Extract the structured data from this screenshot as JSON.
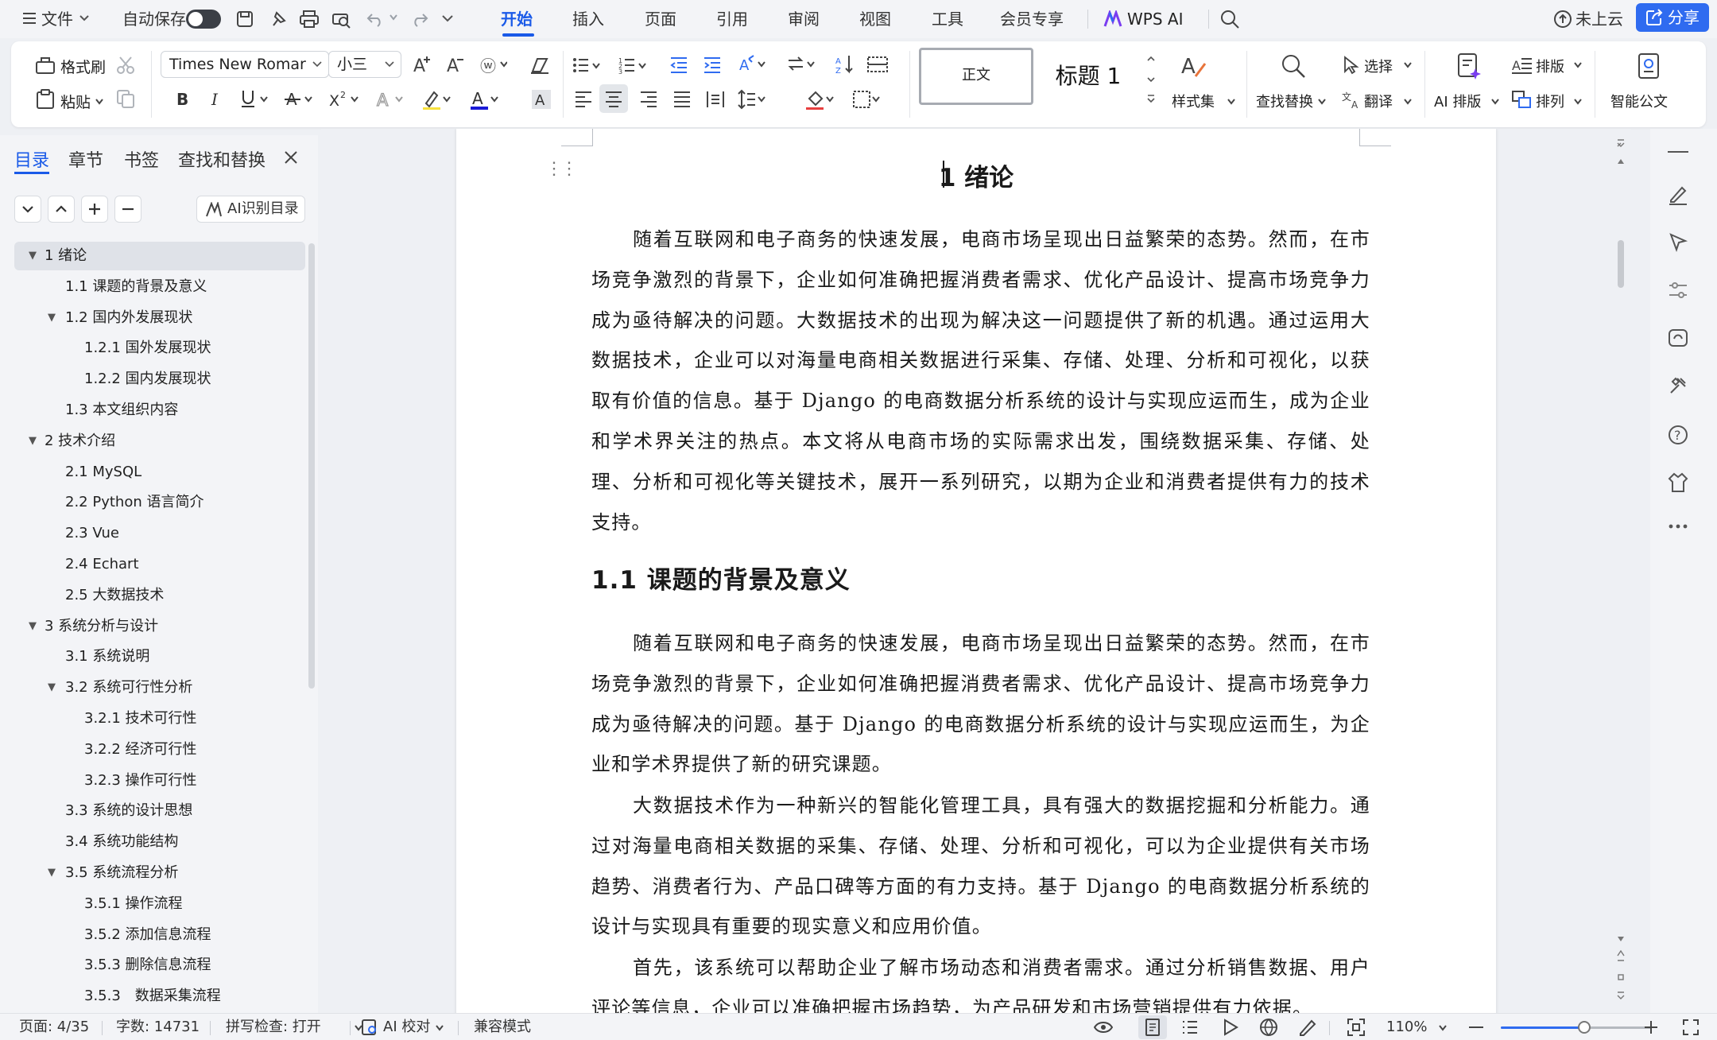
{
  "menubar": {
    "file": "文件",
    "autosave": "自动保存",
    "tabs": [
      "开始",
      "插入",
      "页面",
      "引用",
      "审阅",
      "视图",
      "工具",
      "会员专享"
    ],
    "active_tab": "开始",
    "wps_ai": "WPS AI",
    "cloud": "未上云",
    "share": "分享"
  },
  "ribbon": {
    "format_painter": "格式刷",
    "paste": "粘贴",
    "font_name": "Times New Romar",
    "font_size": "小三",
    "style_normal": "正文",
    "style_heading": "标题 1",
    "style_set": "样式集",
    "find_replace": "查找替换",
    "select": "选择",
    "translate": "翻译",
    "ai_layout": "AI 排版",
    "typeset": "排版",
    "arrange": "排列",
    "smart_doc": "智能公文",
    "font_color": "#1a1ad6"
  },
  "nav": {
    "tabs": [
      "目录",
      "章节",
      "书签",
      "查找和替换"
    ],
    "ai_toc": "AI识别目录",
    "toc": [
      {
        "label": "1  绪论",
        "level": 1,
        "expanded": true,
        "selected": true
      },
      {
        "label": "1.1  课题的背景及意义",
        "level": 2
      },
      {
        "label": "1.2  国内外发展现状",
        "level": 2,
        "expanded": true
      },
      {
        "label": "1.2.1  国外发展现状",
        "level": 3
      },
      {
        "label": "1.2.2  国内发展现状",
        "level": 3
      },
      {
        "label": "1.3  本文组织内容",
        "level": 2
      },
      {
        "label": "2  技术介绍",
        "level": 1,
        "expanded": true
      },
      {
        "label": "2.1 MySQL",
        "level": 2
      },
      {
        "label": "2.2 Python 语言简介",
        "level": 2
      },
      {
        "label": "2.3 Vue",
        "level": 2
      },
      {
        "label": "2.4 Echart",
        "level": 2
      },
      {
        "label": "2.5  大数据技术",
        "level": 2
      },
      {
        "label": "3 系统分析与设计",
        "level": 1,
        "expanded": true
      },
      {
        "label": "3.1 系统说明",
        "level": 2
      },
      {
        "label": "3.2 系统可行性分析",
        "level": 2,
        "expanded": true
      },
      {
        "label": "3.2.1 技术可行性",
        "level": 3
      },
      {
        "label": "3.2.2 经济可行性",
        "level": 3
      },
      {
        "label": "3.2.3 操作可行性",
        "level": 3
      },
      {
        "label": "3.3 系统的设计思想",
        "level": 2
      },
      {
        "label": "3.4 系统功能结构",
        "level": 2
      },
      {
        "label": "3.5 系统流程分析",
        "level": 2,
        "expanded": true
      },
      {
        "label": "3.5.1 操作流程",
        "level": 3
      },
      {
        "label": "3.5.2 添加信息流程",
        "level": 3
      },
      {
        "label": "3.5.3 删除信息流程",
        "level": 3
      },
      {
        "label": "3.5.3　数据采集流程",
        "level": 3
      }
    ]
  },
  "document": {
    "heading1": "1  绪论",
    "para1": "随着互联网和电子商务的快速发展，电商市场呈现出日益繁荣的态势。然而，在市场竞争激烈的背景下，企业如何准确把握消费者需求、优化产品设计、提高市场竞争力成为亟待解决的问题。大数据技术的出现为解决这一问题提供了新的机遇。通过运用大数据技术，企业可以对海量电商相关数据进行采集、存储、处理、分析和可视化，以获取有价值的信息。基于 Django 的电商数据分析系统的设计与实现应运而生，成为企业和学术界关注的热点。本文将从电商市场的实际需求出发，围绕数据采集、存储、处理、分析和可视化等关键技术，展开一系列研究，以期为企业和消费者提供有力的技术支持。",
    "heading2": "1.1  课题的背景及意义",
    "para2": "随着互联网和电子商务的快速发展，电商市场呈现出日益繁荣的态势。然而，在市场竞争激烈的背景下，企业如何准确把握消费者需求、优化产品设计、提高市场竞争力成为亟待解决的问题。基于 Django 的电商数据分析系统的设计与实现应运而生，为企业和学术界提供了新的研究课题。",
    "para3": "大数据技术作为一种新兴的智能化管理工具，具有强大的数据挖掘和分析能力。通过对海量电商相关数据的采集、存储、处理、分析和可视化，可以为企业提供有关市场趋势、消费者行为、产品口碑等方面的有力支持。基于 Django 的电商数据分析系统的设计与实现具有重要的现实意义和应用价值。",
    "para4": "首先，该系统可以帮助企业了解市场动态和消费者需求。通过分析销售数据、用户评论等信息，企业可以准确把握市场趋势，为产品研发和市场营销提供有力依据。"
  },
  "status": {
    "page": "页面: 4/35",
    "words": "字数: 14731",
    "spell": "拼写检查: 打开",
    "ai_check": "AI 校对",
    "compat": "兼容模式",
    "zoom": "110%",
    "zoom_level": 0.55
  }
}
